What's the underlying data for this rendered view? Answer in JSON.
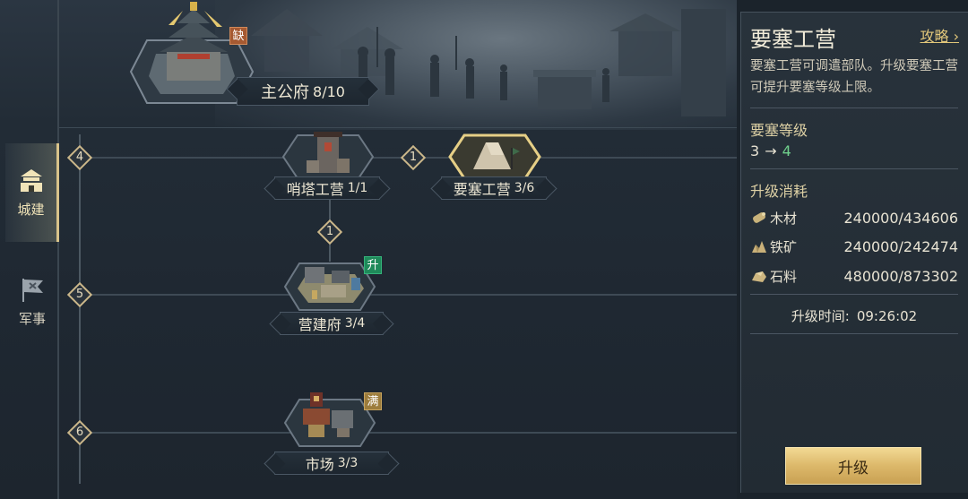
{
  "nav": {
    "items": [
      {
        "label": "城建",
        "icon": "city-icon",
        "active": true
      },
      {
        "label": "军事",
        "icon": "flag-icon",
        "active": false
      }
    ]
  },
  "tree": {
    "tiers": [
      "4",
      "5",
      "6"
    ],
    "link_tiers": [
      "1",
      "1"
    ],
    "buildings": {
      "main_palace": {
        "name": "主公府",
        "count": "8/10",
        "badge": "缺"
      },
      "tower_camp": {
        "name": "哨塔工营",
        "count": "1/1"
      },
      "fortress_camp": {
        "name": "要塞工营",
        "count": "3/6"
      },
      "construction_office": {
        "name": "营建府",
        "count": "3/4",
        "badge": "升"
      },
      "market": {
        "name": "市场",
        "count": "3/3",
        "badge": "满"
      }
    }
  },
  "panel": {
    "title": "要塞工营",
    "guide_label": "攻略",
    "description": "要塞工营可调遣部队。升级要塞工营可提升要塞等级上限。",
    "level_heading": "要塞等级",
    "level_from": "3",
    "level_arrow": "→",
    "level_to": "4",
    "cost_heading": "升级消耗",
    "costs": [
      {
        "name": "木材",
        "value": "240000/434606",
        "icon": "wood-icon"
      },
      {
        "name": "铁矿",
        "value": "240000/242474",
        "icon": "iron-ore-icon"
      },
      {
        "name": "石料",
        "value": "480000/873302",
        "icon": "stone-icon"
      }
    ],
    "time_label": "升级时间:",
    "time_value": "09:26:02",
    "upgrade_button": "升级"
  },
  "colors": {
    "accent_gold": "#e2c77a",
    "level_up_green": "#6fd08c",
    "badge_upgrade": "#1f8a5a",
    "badge_missing": "#a65a32",
    "badge_full": "#9c7c3c"
  }
}
